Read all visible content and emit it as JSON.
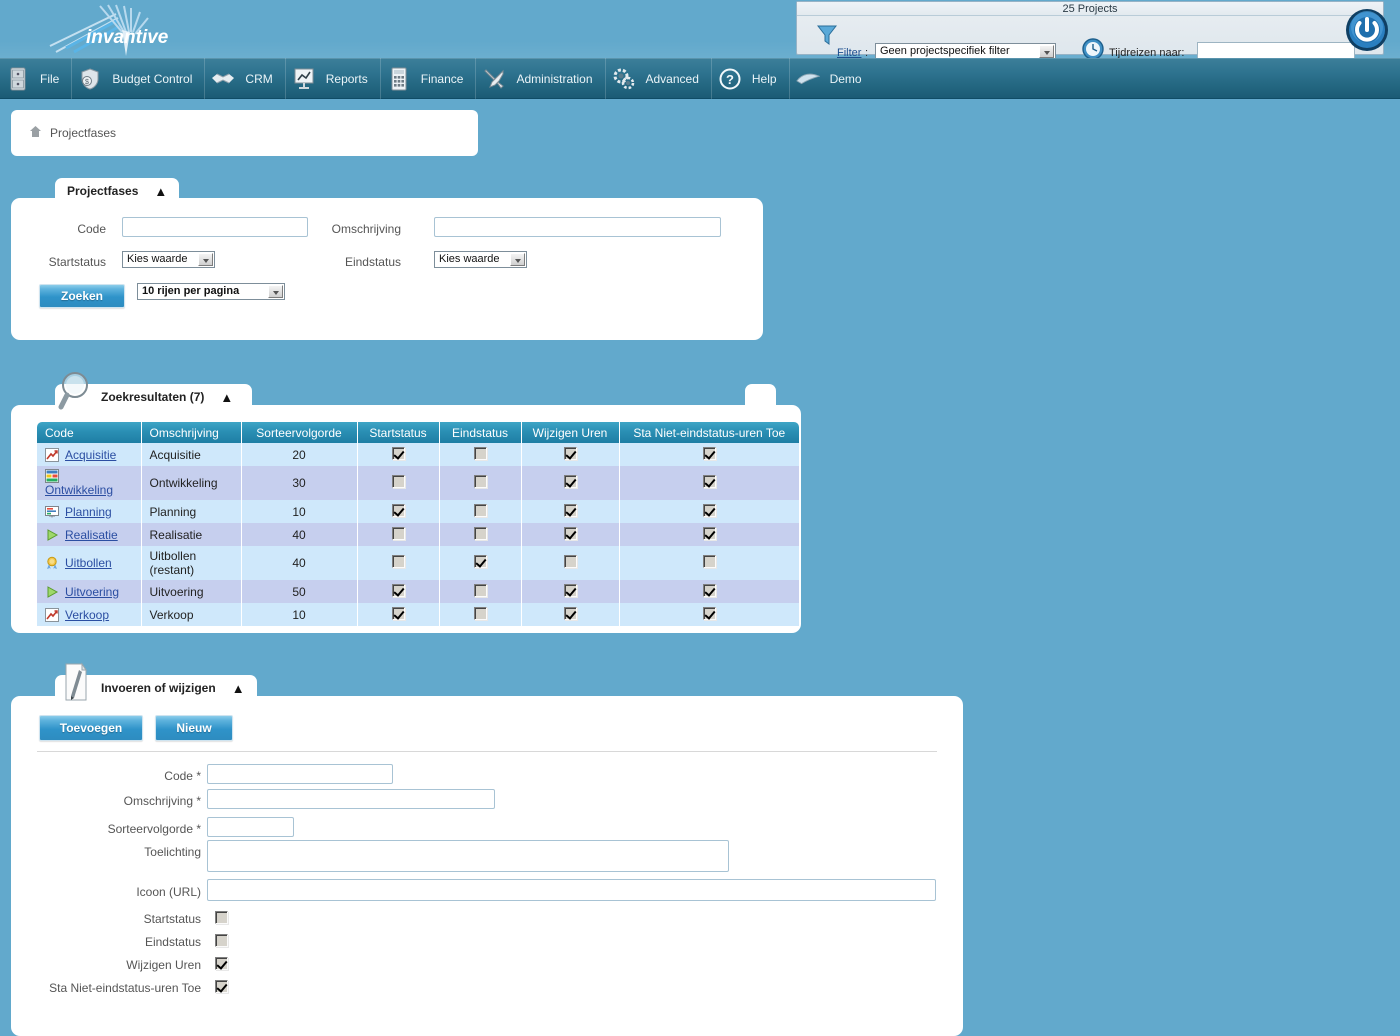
{
  "app": {
    "brand": "invantive"
  },
  "topbar": {
    "projects_count": "25 Projects",
    "filter_label": "Filter",
    "filter_colon": ":",
    "filter_value": "Geen projectspecifiek filter",
    "timetravel_label": "Tijdreizen naar:",
    "timetravel_value": "",
    "funnel_icon": "funnel-icon",
    "clock_icon": "clock-icon",
    "power_icon": "power-icon"
  },
  "menu": {
    "items": [
      {
        "label": "File",
        "icon": "cabinet-icon"
      },
      {
        "label": "Budget Control",
        "icon": "money-shield-icon"
      },
      {
        "label": "CRM",
        "icon": "handshake-icon"
      },
      {
        "label": "Reports",
        "icon": "presentation-chart-icon"
      },
      {
        "label": "Finance",
        "icon": "calculator-icon"
      },
      {
        "label": "Administration",
        "icon": "tools-icon"
      },
      {
        "label": "Advanced",
        "icon": "gears-icon"
      },
      {
        "label": "Help",
        "icon": "question-circle-icon"
      },
      {
        "label": "Demo",
        "icon": "bird-icon"
      }
    ]
  },
  "breadcrumb": {
    "home_icon": "home-icon",
    "text": "Projectfases"
  },
  "search_panel": {
    "tab_title": "Projectfases",
    "collapse_icon": "chevron-up-icon",
    "code_label": "Code",
    "code_value": "",
    "omschrijving_label": "Omschrijving",
    "omschrijving_value": "",
    "startstatus_label": "Startstatus",
    "startstatus_value": "Kies waarde",
    "eindstatus_label": "Eindstatus",
    "eindstatus_value": "Kies waarde",
    "search_button": "Zoeken",
    "rows_per_page": "10 rijen per pagina"
  },
  "results_panel": {
    "tab_title": "Zoekresultaten (7)",
    "collapse_icon": "chevron-up-icon",
    "magnifier_icon": "magnifier-icon",
    "columns": [
      "Code",
      "Omschrijving",
      "Sorteervolgorde",
      "Startstatus",
      "Eindstatus",
      "Wijzigen Uren",
      "Sta Niet-eindstatus-uren Toe"
    ],
    "rows": [
      {
        "icon": "chart-up-icon",
        "code": "Acquisitie",
        "omschrijving": "Acquisitie",
        "sorteervolgorde": "20",
        "startstatus": true,
        "eindstatus": false,
        "wijzigen_uren": true,
        "sta_niet_eindstatus": true
      },
      {
        "icon": "spreadsheet-icon",
        "code": "Ontwikkeling",
        "omschrijving": "Ontwikkeling",
        "sorteervolgorde": "30",
        "startstatus": false,
        "eindstatus": false,
        "wijzigen_uren": true,
        "sta_niet_eindstatus": true
      },
      {
        "icon": "planboard-icon",
        "code": "Planning",
        "omschrijving": "Planning",
        "sorteervolgorde": "10",
        "startstatus": true,
        "eindstatus": false,
        "wijzigen_uren": true,
        "sta_niet_eindstatus": true
      },
      {
        "icon": "play-green-icon",
        "code": "Realisatie",
        "omschrijving": "Realisatie",
        "sorteervolgorde": "40",
        "startstatus": false,
        "eindstatus": false,
        "wijzigen_uren": true,
        "sta_niet_eindstatus": true
      },
      {
        "icon": "medal-icon",
        "code": "Uitbollen",
        "omschrijving": "Uitbollen (restant)",
        "sorteervolgorde": "40",
        "startstatus": false,
        "eindstatus": true,
        "wijzigen_uren": false,
        "sta_niet_eindstatus": false
      },
      {
        "icon": "play-green-icon",
        "code": "Uitvoering",
        "omschrijving": "Uitvoering",
        "sorteervolgorde": "50",
        "startstatus": true,
        "eindstatus": false,
        "wijzigen_uren": true,
        "sta_niet_eindstatus": true
      },
      {
        "icon": "chart-up-icon",
        "code": "Verkoop",
        "omschrijving": "Verkoop",
        "sorteervolgorde": "10",
        "startstatus": true,
        "eindstatus": false,
        "wijzigen_uren": true,
        "sta_niet_eindstatus": true
      }
    ]
  },
  "entry_panel": {
    "tab_title": "Invoeren of wijzigen",
    "collapse_icon": "chevron-up-icon",
    "pencil_icon": "pencil-icon",
    "add_button": "Toevoegen",
    "new_button": "Nieuw",
    "fields": {
      "code_label": "Code *",
      "code_value": "",
      "omschrijving_label": "Omschrijving *",
      "omschrijving_value": "",
      "sorteervolgorde_label": "Sorteervolgorde *",
      "sorteervolgorde_value": "",
      "toelichting_label": "Toelichting",
      "toelichting_value": "",
      "icoon_label": "Icoon (URL)",
      "icoon_value": "",
      "startstatus_label": "Startstatus",
      "startstatus_checked": false,
      "eindstatus_label": "Eindstatus",
      "eindstatus_checked": false,
      "wijzigen_uren_label": "Wijzigen Uren",
      "wijzigen_uren_checked": true,
      "sta_niet_label": "Sta Niet-eindstatus-uren Toe",
      "sta_niet_checked": true
    }
  },
  "colors": {
    "page_background": "#62a9cc",
    "banner_dark": "#0d4a6d",
    "menu_teal": "#2e738f",
    "grid_header": "#2a8fb4",
    "row_odd": "#cfe8fb",
    "row_even": "#c6cfee",
    "link": "#2b4ea2",
    "button_blue": "#2f93c9"
  }
}
